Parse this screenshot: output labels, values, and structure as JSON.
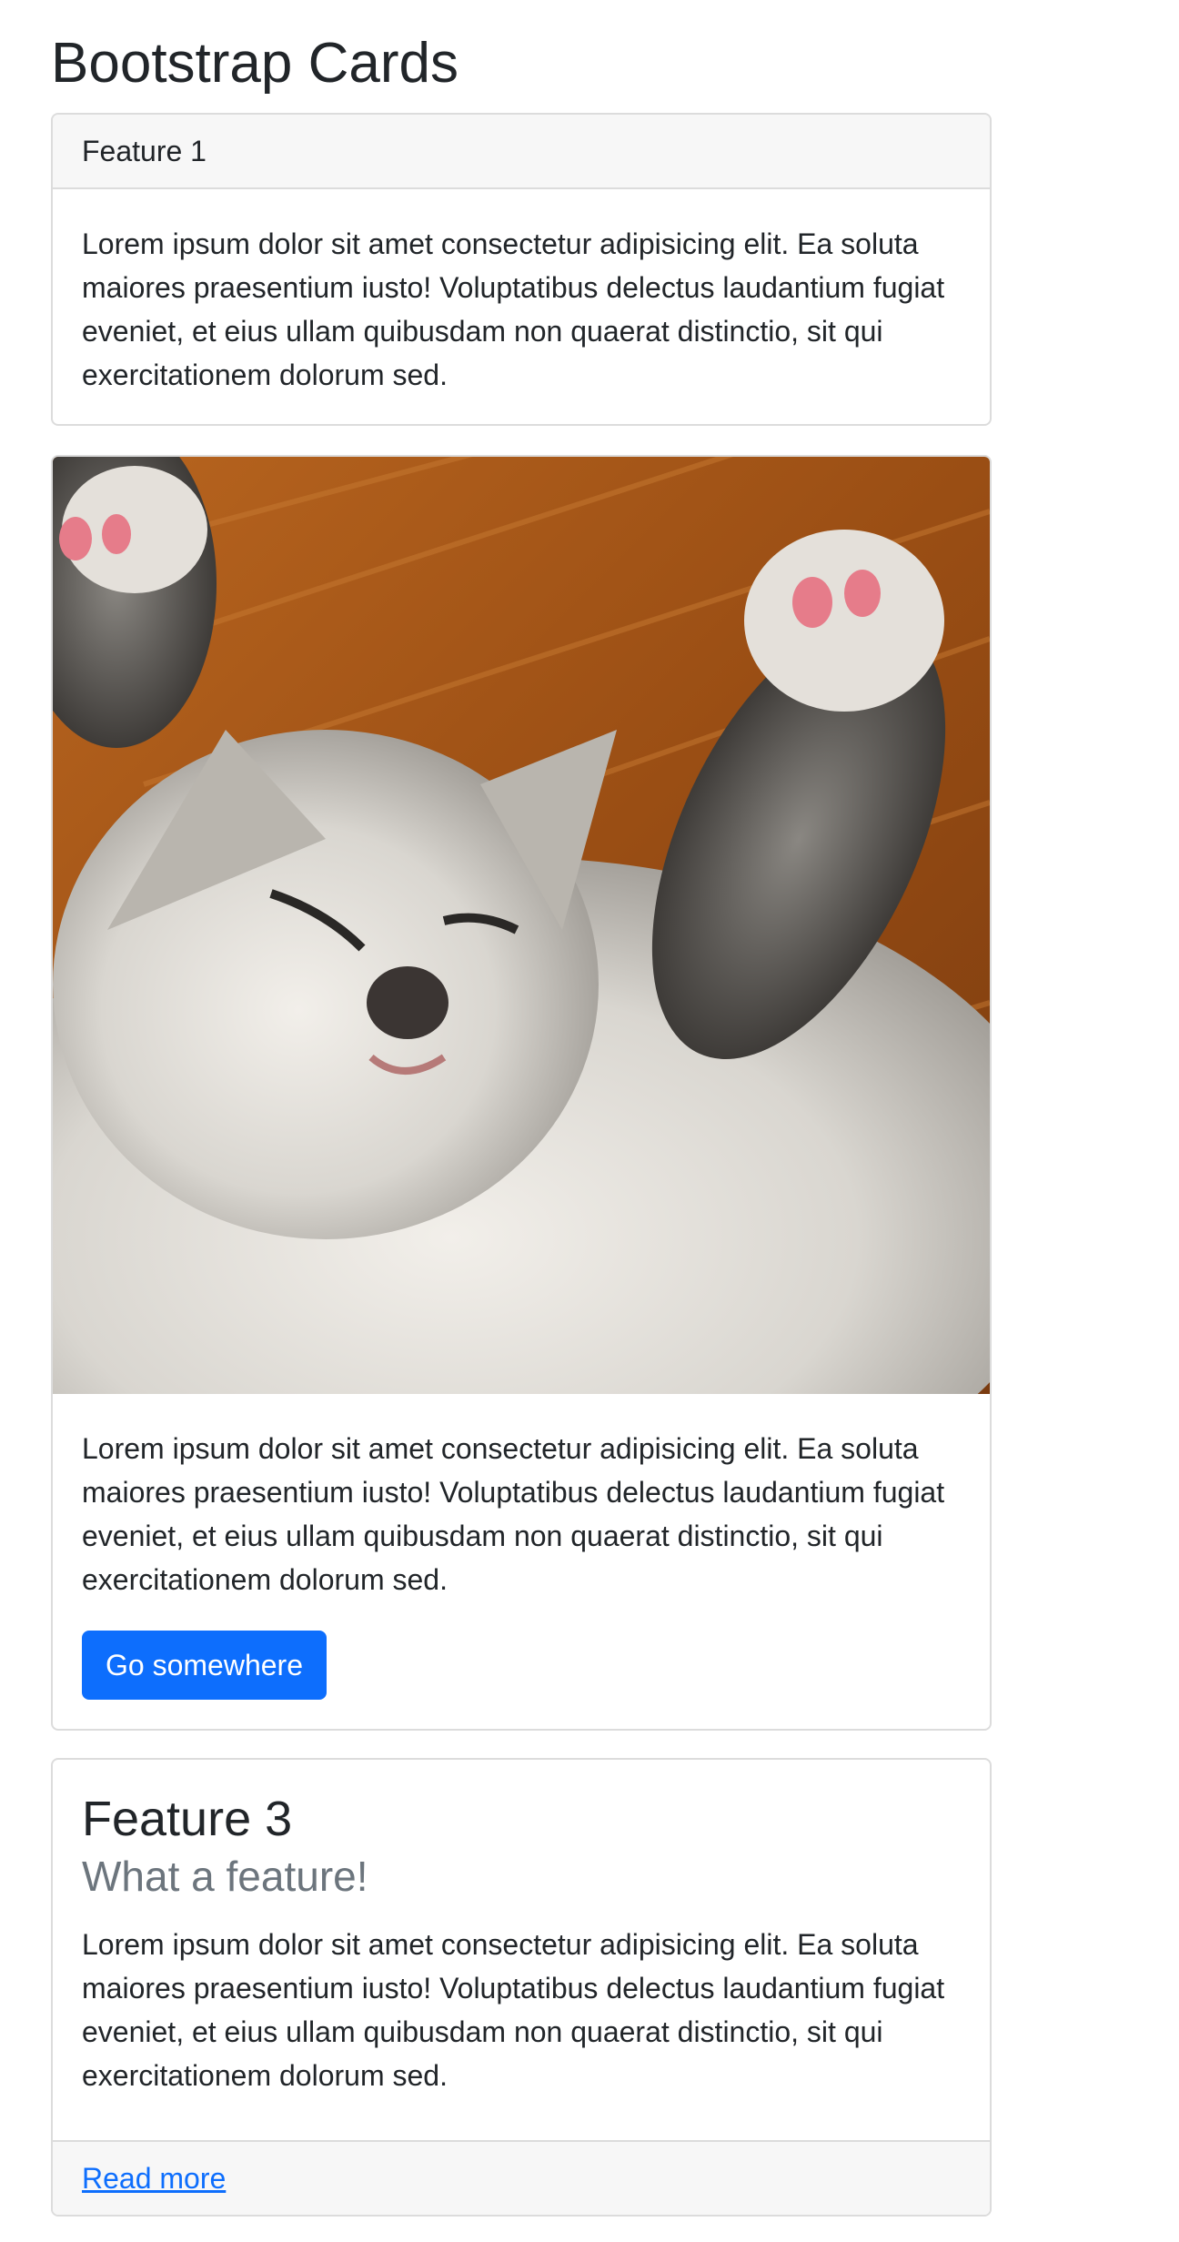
{
  "page": {
    "title": "Bootstrap Cards"
  },
  "cards": [
    {
      "header": "Feature 1",
      "text": "Lorem ipsum dolor sit amet consectetur adipisicing elit. Ea soluta maiores praesentium iusto! Voluptatibus delectus laudantium fugiat eveniet, et eius ullam quibusdam non quaerat distinctio, sit qui exercitationem dolorum sed."
    },
    {
      "image_alt": "kitten-sleeping-photo",
      "text": "Lorem ipsum dolor sit amet consectetur adipisicing elit. Ea soluta maiores praesentium iusto! Voluptatibus delectus laudantium fugiat eveniet, et eius ullam quibusdam non quaerat distinctio, sit qui exercitationem dolorum sed.",
      "button_label": "Go somewhere"
    },
    {
      "title": "Feature 3",
      "subtitle": "What a feature!",
      "text": "Lorem ipsum dolor sit amet consectetur adipisicing elit. Ea soluta maiores praesentium iusto! Voluptatibus delectus laudantium fugiat eveniet, et eius ullam quibusdam non quaerat distinctio, sit qui exercitationem dolorum sed.",
      "footer_link": "Read more"
    }
  ],
  "colors": {
    "primary": "#0d6efd",
    "muted": "#6c757d",
    "border": "#dcdcdc",
    "header_bg": "#f7f7f7"
  }
}
